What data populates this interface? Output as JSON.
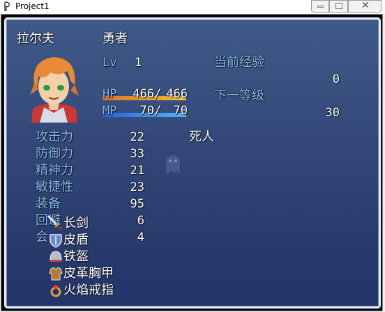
{
  "window": {
    "title": "Project1"
  },
  "actor": {
    "name": "拉尔夫",
    "class": "勇者",
    "level_label": "Lv",
    "level": "1",
    "hp_label": "HP",
    "hp": "466",
    "hp_max": "466",
    "mp_label": "MP",
    "mp": "70",
    "mp_max": "70",
    "hp_rate": 1.0,
    "mp_rate": 1.0,
    "state": "死人"
  },
  "exp": {
    "current_label": "当前经验",
    "current": "0",
    "next_label": "下一等级",
    "next": "30"
  },
  "params": [
    {
      "label": "攻击力",
      "value": "22"
    },
    {
      "label": "防御力",
      "value": "33"
    },
    {
      "label": "精神力",
      "value": "21"
    },
    {
      "label": "敏捷性",
      "value": "23"
    },
    {
      "label": "装备",
      "value": "95"
    },
    {
      "label": "回避",
      "value": "6"
    },
    {
      "label": "会",
      "value": "4"
    }
  ],
  "equipment": [
    {
      "icon": "sword-icon",
      "name": "长剑"
    },
    {
      "icon": "shield-icon",
      "name": "皮盾"
    },
    {
      "icon": "helmet-icon",
      "name": "铁盔"
    },
    {
      "icon": "armor-icon",
      "name": "皮革胸甲"
    },
    {
      "icon": "ring-icon",
      "name": "火焰戒指"
    }
  ],
  "colors": {
    "system": "#86b8e8",
    "normal": "#ffffff",
    "window_top": "#3f5a88",
    "window_bottom": "#22346a"
  }
}
